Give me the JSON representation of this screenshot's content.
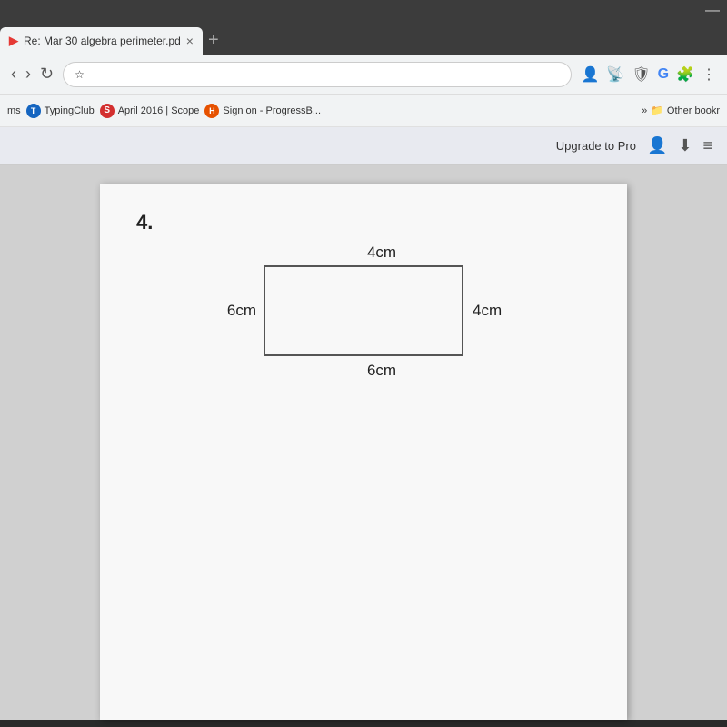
{
  "browser": {
    "tab": {
      "label": "Re: Mar 30 algebra perimeter.pd",
      "close_icon": "×",
      "new_tab_icon": "+"
    },
    "toolbar": {
      "star_icon": "☆",
      "minimize_icon": "—"
    },
    "bookmarks": {
      "items": [
        {
          "id": "typing-club",
          "label": "TypingClub",
          "icon_text": "T"
        },
        {
          "id": "scope",
          "label": "April 2016 | Scope",
          "icon_text": "S"
        },
        {
          "id": "progress",
          "label": "Sign on - ProgressB...",
          "icon_text": "H"
        }
      ],
      "more_icon": "»",
      "other_label": "Other bookr"
    },
    "pdf_toolbar": {
      "upgrade_label": "Upgrade to Pro",
      "person_icon": "👤",
      "download_icon": "⬇",
      "menu_icon": "≡"
    }
  },
  "pdf": {
    "problem_number": "4.",
    "shape": "rectangle",
    "dimensions": {
      "top": "4cm",
      "bottom": "6cm",
      "left": "6cm",
      "right": "4cm"
    }
  }
}
